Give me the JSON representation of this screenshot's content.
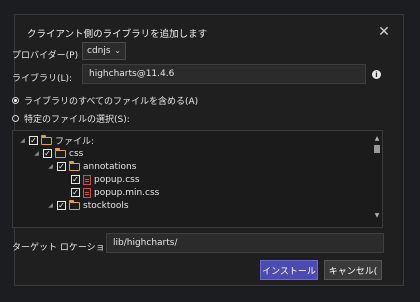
{
  "dialog": {
    "title": "クライアント側のライブラリを追加します",
    "close_glyph": "✕"
  },
  "provider": {
    "label": "プロバイダー(P)",
    "selected": "cdnjs",
    "chevron": "⌄"
  },
  "library": {
    "label": "ライブラリ(L):",
    "value": "highcharts@11.4.6",
    "info_glyph": "i"
  },
  "options": {
    "all_files": "ライブラリのすべてのファイルを含める(A)",
    "specific_files": "特定のファイルの選択(S):",
    "selected": "all_files"
  },
  "tree": {
    "root": {
      "label": "ファイル:",
      "checked": true
    },
    "css": {
      "label": "css",
      "checked": true
    },
    "annotations": {
      "label": "annotations",
      "checked": true
    },
    "file1": {
      "label": "popup.css",
      "checked": true
    },
    "file2": {
      "label": "popup.min.css",
      "checked": true
    },
    "stocktools": {
      "label": "stocktools",
      "checked": true
    },
    "check_glyph": "✓",
    "expander_glyph": "◢"
  },
  "target": {
    "label": "ターゲット ロケーション(T):",
    "value": "lib/highcharts/"
  },
  "buttons": {
    "install": "インストール",
    "cancel": "キャンセル("
  },
  "colors": {
    "accent": "#4b4bb1",
    "folder": "#d9a441",
    "file": "#c5524a",
    "background": "#1f1f1f"
  },
  "icons": [
    "close-icon",
    "chevron-down-icon",
    "info-icon",
    "folder-icon",
    "css-file-icon",
    "checkbox-icon",
    "scroll-up-icon",
    "scroll-down-icon"
  ]
}
